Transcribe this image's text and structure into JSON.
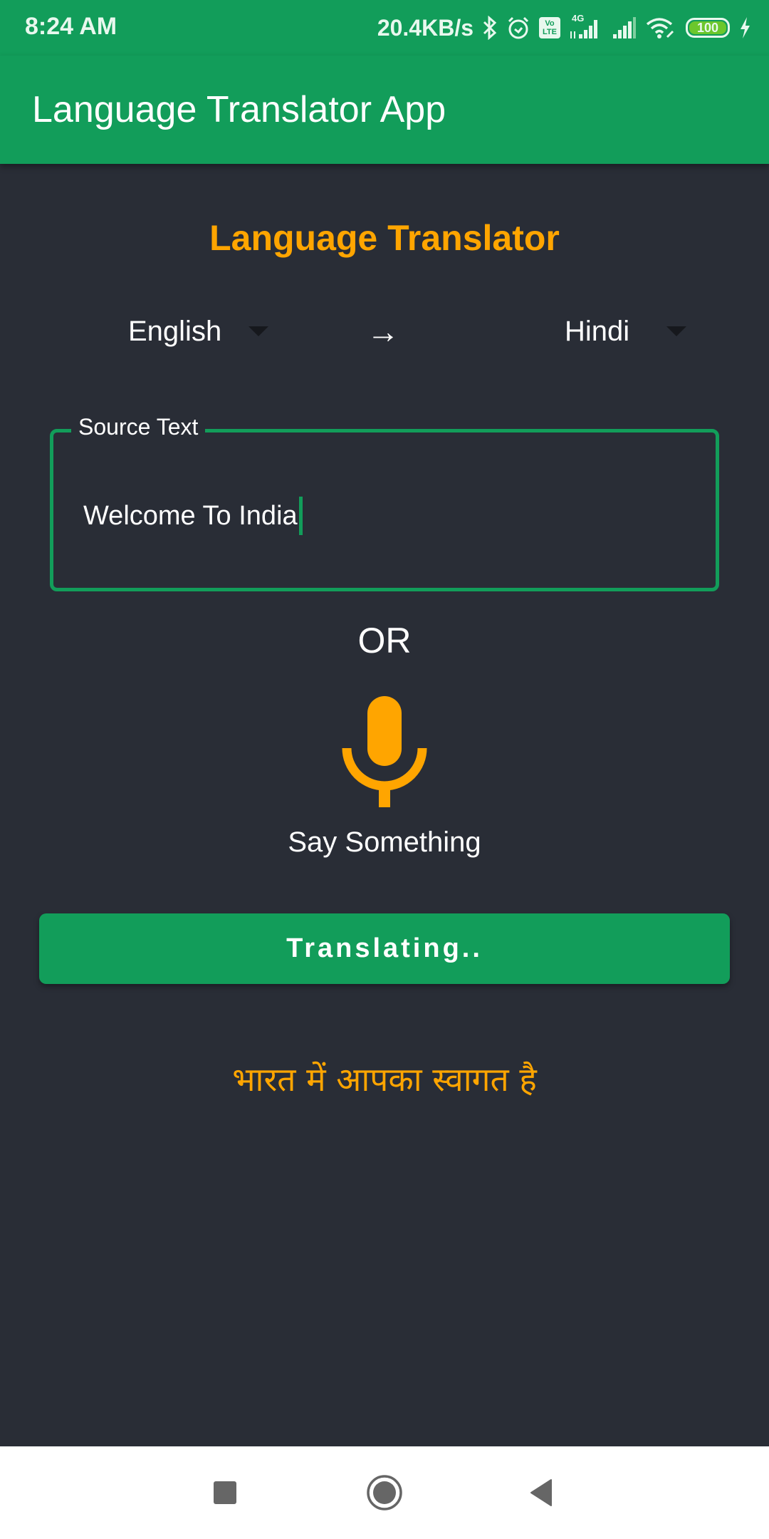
{
  "status_bar": {
    "time": "8:24 AM",
    "net_speed": "20.4KB/s",
    "icons": [
      "bluetooth-icon",
      "alarm-icon",
      "volte-icon",
      "signal-4g-icon",
      "signal-icon",
      "wifi-icon",
      "battery-icon",
      "charging-icon"
    ],
    "volte_top": "Vo",
    "volte_bottom": "LTE",
    "network_type": "4G",
    "battery_level": "100"
  },
  "app_bar": {
    "title": "Language Translator App"
  },
  "main": {
    "heading": "Language Translator",
    "source_language": "English",
    "target_language": "Hindi",
    "swap_icon": "arrow-right-icon",
    "source_field": {
      "label": "Source Text",
      "value": "Welcome To India"
    },
    "or_text": "OR",
    "mic_icon": "microphone-icon",
    "say_label": "Say Something",
    "translate_button": "Translating..",
    "result": "भारत में आपका स्वागत है"
  },
  "colors": {
    "primary": "#129d5a",
    "accent": "#ffa500",
    "background": "#292d36"
  },
  "nav_bar": {
    "recents": "recents-icon",
    "home": "home-icon",
    "back": "back-icon"
  }
}
